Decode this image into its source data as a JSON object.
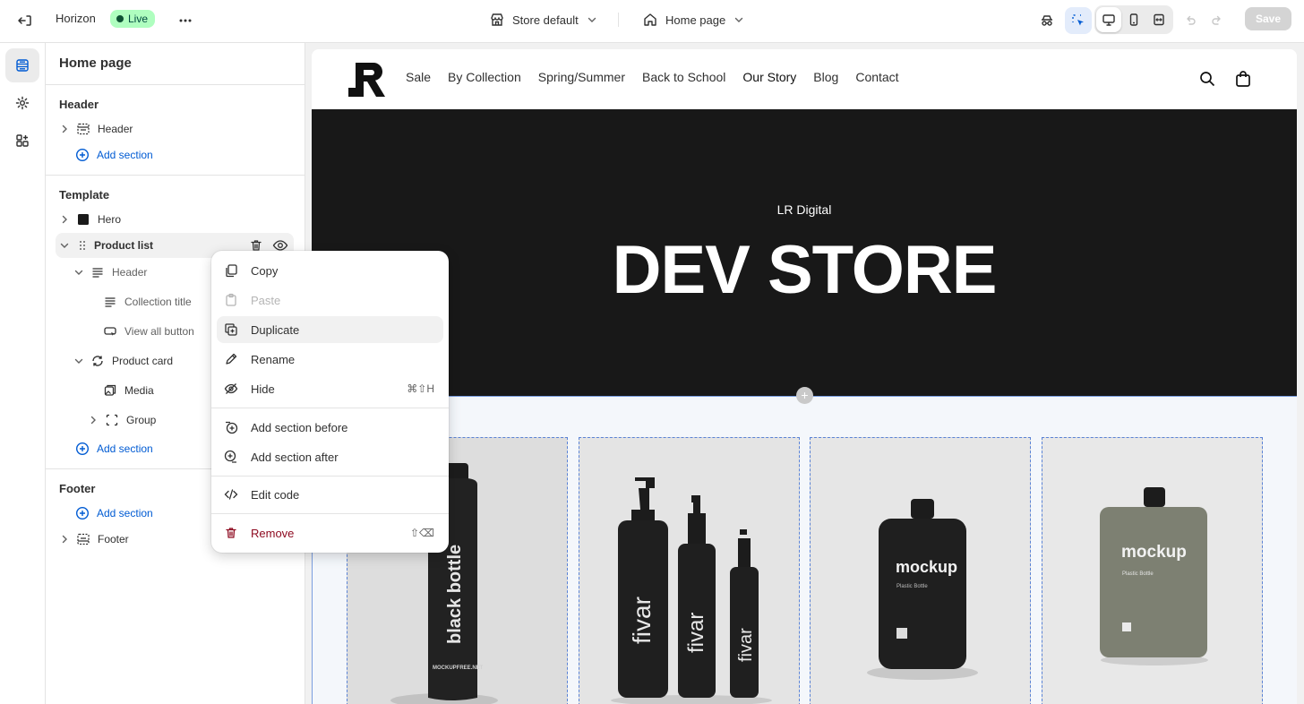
{
  "topbar": {
    "app_name": "Horizon",
    "status_badge": "Live",
    "theme_select": "Store default",
    "page_select": "Home page",
    "save_label": "Save"
  },
  "sidebar": {
    "title": "Home page",
    "header_group": "Header",
    "header_item": "Header",
    "add_section": "Add section",
    "template_group": "Template",
    "hero_item": "Hero",
    "product_list_item": "Product list",
    "pl_header": "Header",
    "collection_title": "Collection title",
    "view_all_button": "View all button",
    "product_card": "Product card",
    "media": "Media",
    "group": "Group",
    "footer_group": "Footer",
    "footer_item": "Footer"
  },
  "context_menu": {
    "copy": "Copy",
    "paste": "Paste",
    "duplicate": "Duplicate",
    "rename": "Rename",
    "hide": "Hide",
    "hide_shortcut": "⌘⇧H",
    "add_before": "Add section before",
    "add_after": "Add section after",
    "edit_code": "Edit code",
    "remove": "Remove",
    "remove_shortcut": "⇧⌫"
  },
  "preview": {
    "nav": [
      "Sale",
      "By Collection",
      "Spring/Summer",
      "Back to School",
      "Our Story",
      "Blog",
      "Contact"
    ],
    "hero_subtitle": "LR Digital",
    "hero_title": "DEV STORE",
    "products": [
      {
        "bottle_text": "black bottle",
        "brand_text": "MOCKUPFREE.NET"
      },
      {
        "bottle_text": "fivar"
      },
      {
        "bottle_text": "mockup",
        "sub_text": "Plastic Bottle"
      },
      {
        "bottle_text": "mockup",
        "sub_text": "Plastic Bottle"
      }
    ]
  },
  "colors": {
    "accent_blue": "#005bd3",
    "live_badge_bg": "#affebf",
    "danger_red": "#8e0b21",
    "hero_bg": "#181818"
  }
}
